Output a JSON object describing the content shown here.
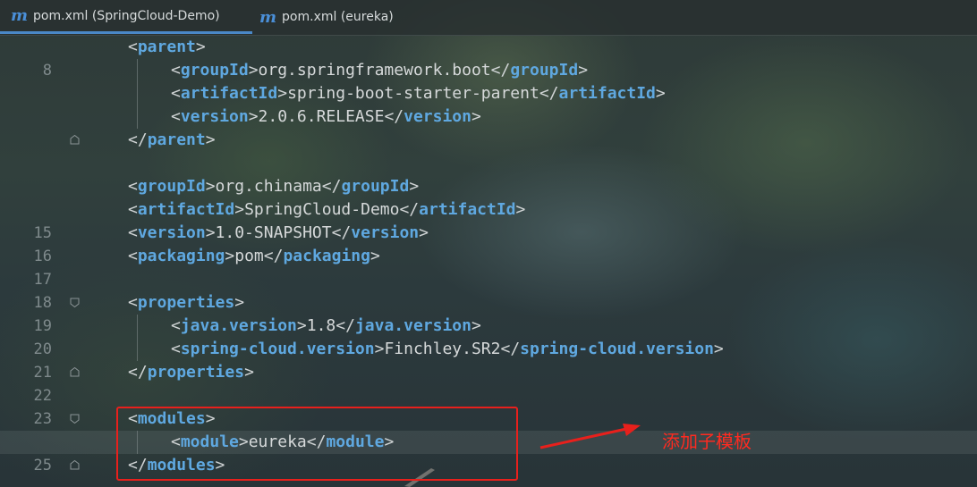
{
  "tabs": [
    {
      "label": "pom.xml (SpringCloud-Demo)",
      "active": true
    },
    {
      "label": "pom.xml (eureka)",
      "active": false
    }
  ],
  "line_numbers": {
    "n8": "8",
    "n15": "15",
    "n16": "16",
    "n17": "17",
    "n18": "18",
    "n19": "19",
    "n20": "20",
    "n21": "21",
    "n22": "22",
    "n23": "23",
    "n25": "25"
  },
  "code": {
    "l7": {
      "open": "parent"
    },
    "l8": {
      "open": "groupId",
      "text": "org.springframework.boot",
      "close": "groupId"
    },
    "l9": {
      "open": "artifactId",
      "text": "spring-boot-starter-parent",
      "close": "artifactId"
    },
    "l10": {
      "open": "version",
      "text": "2.0.6.RELEASE",
      "close": "version"
    },
    "l11": {
      "close": "parent"
    },
    "l13": {
      "open": "groupId",
      "text": "org.chinama",
      "close": "groupId"
    },
    "l14": {
      "open": "artifactId",
      "text": "SpringCloud-Demo",
      "close": "artifactId"
    },
    "l15": {
      "open": "version",
      "text": "1.0-SNAPSHOT",
      "close": "version"
    },
    "l16": {
      "open": "packaging",
      "text": "pom",
      "close": "packaging"
    },
    "l18": {
      "open": "properties"
    },
    "l19": {
      "open": "java.version",
      "text": "1.8",
      "close": "java.version"
    },
    "l20": {
      "open": "spring-cloud.version",
      "text": "Finchley.SR2",
      "close": "spring-cloud.version"
    },
    "l21": {
      "close": "properties"
    },
    "l23": {
      "open": "modules"
    },
    "l24": {
      "open": "module",
      "text": "eureka",
      "close": "module"
    },
    "l25": {
      "close": "modules"
    }
  },
  "annotation": {
    "text": "添加子模板",
    "color": "#ff2a20"
  },
  "colors": {
    "tag": "#5fa8e0",
    "text": "#d6d9da",
    "line_number": "#7f8a8c",
    "highlight_box": "#e8201c",
    "tab_icon": "#4a8fd8"
  },
  "tab_icon": "maven-m-icon"
}
